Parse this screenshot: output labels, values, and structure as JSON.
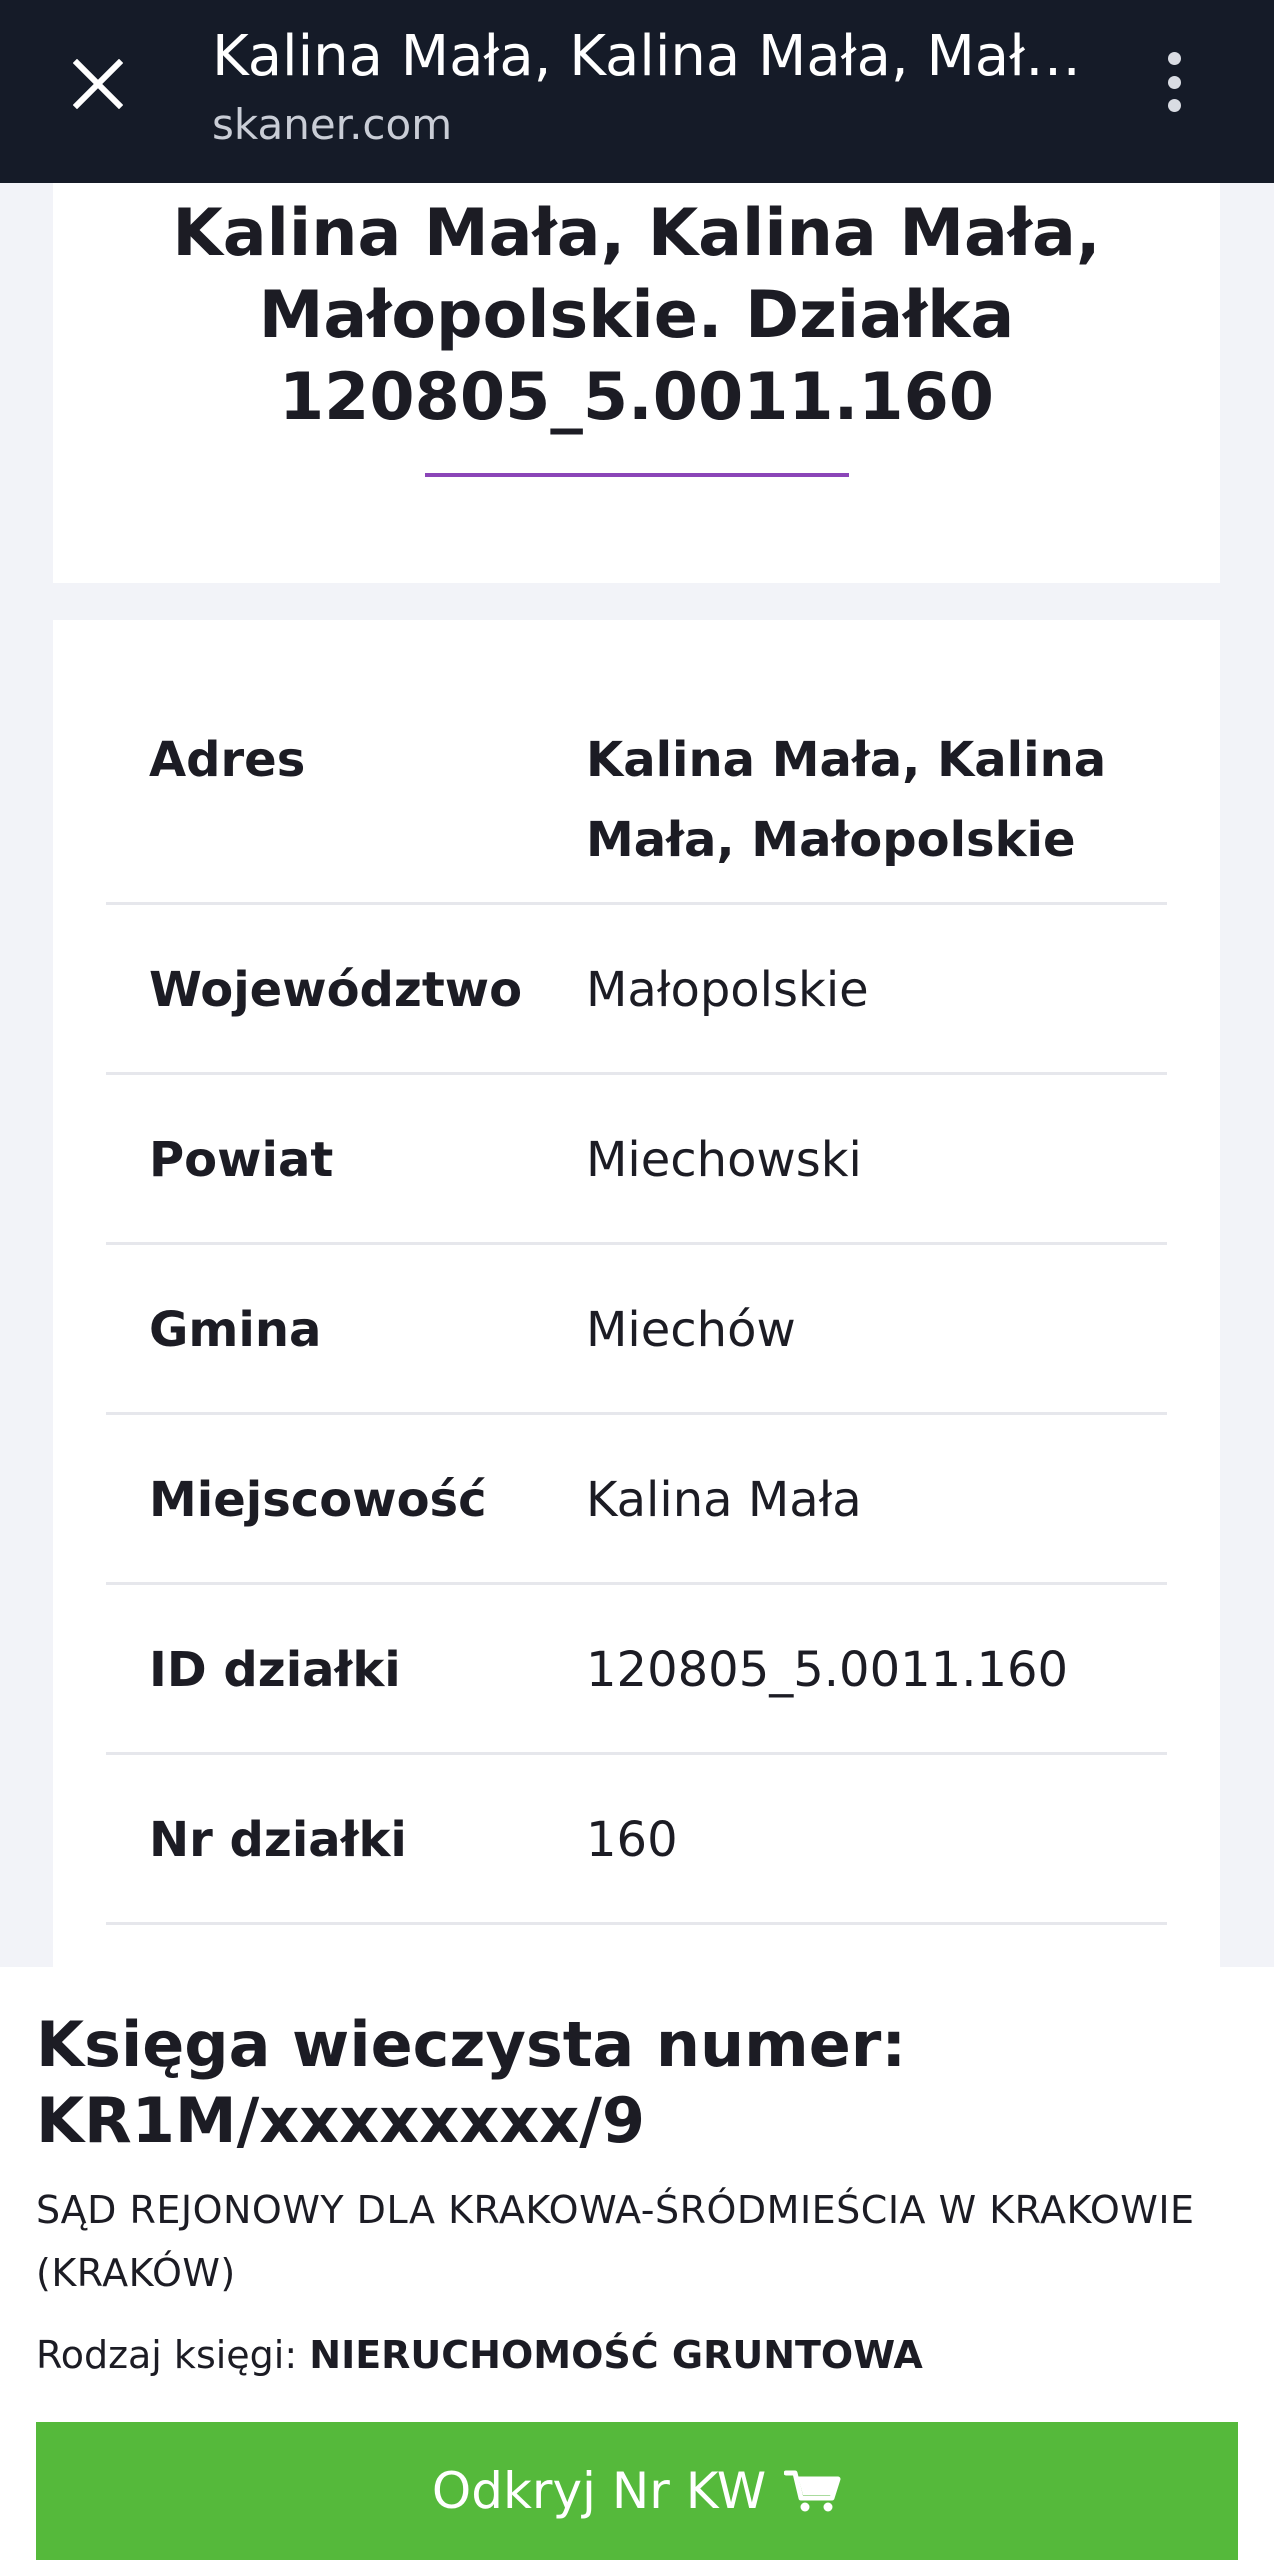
{
  "browser": {
    "tab_title": "Kalina Mała, Kalina Mała, Mało...",
    "url": "skaner.com",
    "close_icon": "close-icon",
    "menu_icon": "more-vertical-icon"
  },
  "page": {
    "title": "Kalina Mała, Kalina Mała, Małopolskie. Działka 120805_5.0011.160",
    "accent_color": "#8b45b8"
  },
  "details": {
    "rows": [
      {
        "label": "Adres",
        "value": "Kalina Mała, Kalina Mała, Małopolskie"
      },
      {
        "label": "Województwo",
        "value": "Małopolskie"
      },
      {
        "label": "Powiat",
        "value": "Miechowski"
      },
      {
        "label": "Gmina",
        "value": "Miechów"
      },
      {
        "label": "Miejscowość",
        "value": "Kalina Mała"
      },
      {
        "label": "ID działki",
        "value": "120805_5.0011.160"
      },
      {
        "label": "Nr działki",
        "value": "160"
      }
    ]
  },
  "land_register": {
    "heading": "Księga wieczysta numer: KR1M/xxxxxxxx/9",
    "court": "SĄD REJONOWY DLA KRAKOWA-ŚRÓDMIEŚCIA W KRAKOWIE (KRAKÓW)",
    "type_label": "Rodzaj księgi:",
    "type_value": "NIERUCHOMOŚĆ GRUNTOWA",
    "button_label": "Odkryj Nr KW",
    "button_icon": "cart-icon",
    "button_color": "#55b93b"
  }
}
